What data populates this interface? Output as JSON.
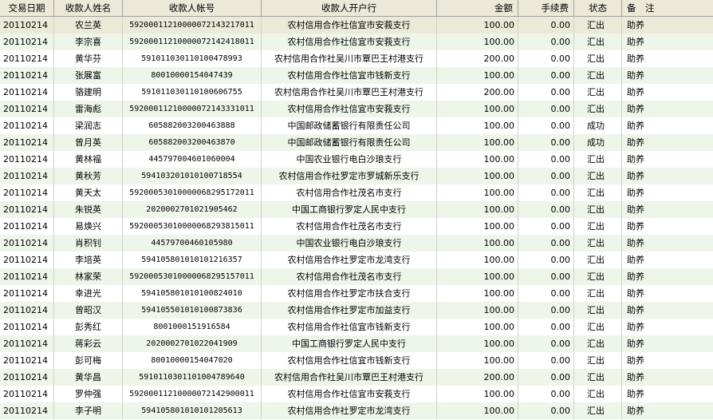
{
  "table": {
    "columns": [
      "交易日期",
      "收款人姓名",
      "收款人帐号",
      "收款人开户行",
      "金额",
      "手续费",
      "状态",
      "备　注"
    ],
    "rows": [
      [
        "20110214",
        "农兰英",
        "59200011210000072143217011",
        "农村信用合作社信宜市安莪支行",
        "100.00",
        "0.00",
        "汇出",
        "助养"
      ],
      [
        "20110214",
        "李宗喜",
        "59200011210000072142418011",
        "农村信用合作社信宜市安莪支行",
        "100.00",
        "0.00",
        "汇出",
        "助养"
      ],
      [
        "20110214",
        "黄华芬",
        "591011030110100478993",
        "农村信用合作社吴川市覃巴王村港支行",
        "200.00",
        "0.00",
        "汇出",
        "助养"
      ],
      [
        "20110214",
        "张展富",
        "80010000154047439",
        "农村信用合作社信宜市钱新支行",
        "100.00",
        "0.00",
        "汇出",
        "助养"
      ],
      [
        "20110214",
        "骆建明",
        "591011030110100606755",
        "农村信用合作社吴川市覃巴王村港支行",
        "200.00",
        "0.00",
        "汇出",
        "助养"
      ],
      [
        "20110214",
        "雷海彪",
        "59200011210000072143331011",
        "农村信用合作社信宜市安莪支行",
        "100.00",
        "0.00",
        "汇出",
        "助养"
      ],
      [
        "20110214",
        "梁润志",
        "605882003200463888",
        "中国邮政储蓄银行有限责任公司",
        "100.00",
        "0.00",
        "成功",
        "助养"
      ],
      [
        "20110214",
        "曾月英",
        "605882003200463870",
        "中国邮政储蓄银行有限责任公司",
        "100.00",
        "0.00",
        "成功",
        "助养"
      ],
      [
        "20110214",
        "黄林福",
        "445797004601060004",
        "中国农业银行电白沙琅支行",
        "100.00",
        "0.00",
        "汇出",
        "助养"
      ],
      [
        "20110214",
        "黄秋芳",
        "594103201010100718554",
        "农村信用合作社罗定市罗城新乐支行",
        "100.00",
        "0.00",
        "汇出",
        "助养"
      ],
      [
        "20110214",
        "黄天太",
        "59200053010000068295172011",
        "农村信用合作社茂名市支行",
        "100.00",
        "0.00",
        "汇出",
        "助养"
      ],
      [
        "20110214",
        "朱锐英",
        "2020002701021905462",
        "中国工商银行罗定人民中支行",
        "100.00",
        "0.00",
        "汇出",
        "助养"
      ],
      [
        "20110214",
        "易焕兴",
        "59200053010000068293815011",
        "农村信用合作社茂名市支行",
        "100.00",
        "0.00",
        "汇出",
        "助养"
      ],
      [
        "20110214",
        "肖积钊",
        "44579700460105980",
        "中国农业银行电白沙琅支行",
        "100.00",
        "0.00",
        "汇出",
        "助养"
      ],
      [
        "20110214",
        "李培英",
        "594105801010101216357",
        "农村信用合作社罗定市龙湾支行",
        "100.00",
        "0.00",
        "汇出",
        "助养"
      ],
      [
        "20110214",
        "林家荣",
        "59200053010000068295157011",
        "农村信用合作社茂名市支行",
        "100.00",
        "0.00",
        "汇出",
        "助养"
      ],
      [
        "20110214",
        "幸进光",
        "594105801010100824010",
        "农村信用合作社罗定市扶合支行",
        "100.00",
        "0.00",
        "汇出",
        "助养"
      ],
      [
        "20110214",
        "曾昭汉",
        "594105501010100873836",
        "农村信用合作社罗定市加益支行",
        "100.00",
        "0.00",
        "汇出",
        "助养"
      ],
      [
        "20110214",
        "彭秀红",
        "8001000151916584",
        "农村信用合作社信宜市钱新支行",
        "100.00",
        "0.00",
        "汇出",
        "助养"
      ],
      [
        "20110214",
        "蒋彩云",
        "2020002701022041909",
        "中国工商银行罗定人民中支行",
        "100.00",
        "0.00",
        "汇出",
        "助养"
      ],
      [
        "20110214",
        "彭可梅",
        "80010000154047020",
        "农村信用合作社信宜市钱新支行",
        "100.00",
        "0.00",
        "汇出",
        "助养"
      ],
      [
        "20110214",
        "黄华昌",
        "591011030110100478964​0",
        "农村信用合作社吴川市覃巴王村港支行",
        "200.00",
        "0.00",
        "汇出",
        "助养"
      ],
      [
        "20110214",
        "罗仲强",
        "59200011210000072142900011",
        "农村信用合作社信宜市安莪支行",
        "100.00",
        "0.00",
        "汇出",
        "助养"
      ],
      [
        "20110214",
        "李子明",
        "594105801010101205613",
        "农村信用合作社罗定市龙湾支行",
        "100.00",
        "0.00",
        "汇出",
        "助养"
      ]
    ]
  }
}
